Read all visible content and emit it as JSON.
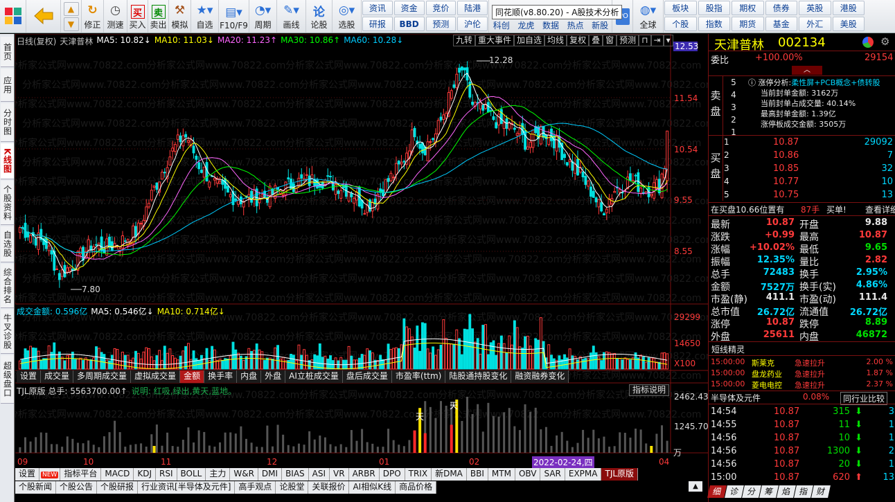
{
  "window_title": "同花顺(v8.80.20) - A股技术分析",
  "toolbar": {
    "buttons": [
      {
        "label": "修正",
        "icon": "refresh-icon"
      },
      {
        "label": "测速",
        "icon": "clock-icon"
      },
      {
        "label": "买入",
        "icon": "buy-icon",
        "glyph": "买"
      },
      {
        "label": "卖出",
        "icon": "sell-icon",
        "glyph": "卖"
      },
      {
        "label": "模拟",
        "icon": "hammer-icon"
      },
      {
        "label": "自选",
        "icon": "star-icon"
      },
      {
        "label": "F10/F9",
        "icon": "f10-icon"
      },
      {
        "label": "周期",
        "icon": "cycle-icon"
      },
      {
        "label": "画线",
        "icon": "pen-icon"
      },
      {
        "label": "论股",
        "icon": "discuss-icon"
      },
      {
        "label": "选股",
        "icon": "select-stock-icon"
      }
    ],
    "grid1": [
      "资讯",
      "资金",
      "竞价",
      "陆港",
      "研报",
      "BBD",
      "预测",
      "沪伦"
    ],
    "grid2": [
      "科创",
      "龙虎",
      "数据",
      "热点",
      "新股"
    ],
    "global_label": "全球",
    "grid3": [
      "板块",
      "股指",
      "期权",
      "债券",
      "英股",
      "港股",
      "个股",
      "指数",
      "期货",
      "基金",
      "外汇",
      "美股"
    ]
  },
  "sidebar_tabs": [
    "首页",
    "应用",
    "分时图",
    "K线图",
    "个股资料",
    "自选股",
    "综合排名",
    "牛叉诊股",
    "超级盘口"
  ],
  "kchart": {
    "header": [
      "日线(复权)",
      "天津普林",
      "MA5: 10.82↓",
      "MA10: 11.03↓",
      "MA20: 11.23↑",
      "MA30: 10.86↑",
      "MA60: 10.28↓"
    ],
    "header_colors": [
      "#c0c0c0",
      "#c0c0c0",
      "#ffffff",
      "#ffff00",
      "#ff66ff",
      "#00ff00",
      "#00ccff"
    ],
    "buttons": [
      "九转",
      "重大事件",
      "加自选",
      "均线",
      "复权",
      "叠",
      "窗",
      "预测"
    ],
    "y_ticks": [
      "12.53",
      "11.54",
      "10.54",
      "9.55",
      "8.55"
    ],
    "high_label": "12.28",
    "low_label": "7.80",
    "watermark": "分析家公式网www.70822.com"
  },
  "volume": {
    "header": [
      "成交金额: 0.596亿",
      "MA5: 0.546亿↓",
      "MA10: 0.714亿↓"
    ],
    "y_ticks": [
      "29299",
      "14650",
      "X100"
    ],
    "tabs": [
      "设置",
      "成交量",
      "多周期成交量",
      "虚拟成交量",
      "金额",
      "换手率",
      "内盘",
      "外盘",
      "AI立桩成交量",
      "盘后成交量",
      "市盈率(ttm)",
      "陆股通持股变化",
      "融资融券变化"
    ],
    "active_tab": "金额"
  },
  "tjl": {
    "title": "TJL原版 总手: 5563700.00↑",
    "note": "说明: 红吸,绿出,黄天,蓝地。",
    "explain_button": "指标说明",
    "y_ticks": [
      "2462.43",
      "1245.70"
    ],
    "unit": "万",
    "marker_tian": "天",
    "marker_xi": "吸"
  },
  "xaxis": {
    "labels": [
      "09",
      "10",
      "11",
      "12",
      "01",
      "02",
      "04"
    ],
    "cursor_date": "2022-02-24,四"
  },
  "indicator_tabs": [
    "设置",
    "NEW",
    "指标平台",
    "MACD",
    "KDJ",
    "RSI",
    "BOLL",
    "主力",
    "W&R",
    "DMI",
    "BIAS",
    "ASI",
    "VR",
    "ARBR",
    "DPO",
    "TRIX",
    "新DMA",
    "BBI",
    "MTM",
    "OBV",
    "SAR",
    "EXPMA",
    "TJL原版"
  ],
  "indicator_active": "TJL原版",
  "bottom_tabs": [
    "个股新闻",
    "个股公告",
    "个股研报",
    "行业资讯[半导体及元件]",
    "高手观点",
    "论股堂",
    "关联报价",
    "AI相似K线",
    "商品价格"
  ],
  "right_panel": {
    "stock_name": "天津普林",
    "stock_code": "002134",
    "weibi_label": "委比",
    "weibi_value": "+100.00%",
    "weibi_vol": "29154",
    "sell_label": "卖盘",
    "sell_nums": [
      "5",
      "4",
      "3",
      "2",
      "1"
    ],
    "limit_title": "涨停分析:",
    "limit_concepts": "柔性屏+PCB概念+债转股",
    "limit_lines": [
      "当前封单金额: 3162万",
      "当前封单占成交量: 40.14%",
      "最高封单金额: 1.39亿",
      "涨停板成交金额: 3505万"
    ],
    "buy_label": "买盘",
    "buy": [
      {
        "n": "1",
        "price": "10.87",
        "vol": "29092"
      },
      {
        "n": "2",
        "price": "10.86",
        "vol": "7"
      },
      {
        "n": "3",
        "price": "10.85",
        "vol": "32"
      },
      {
        "n": "4",
        "price": "10.77",
        "vol": "10"
      },
      {
        "n": "5",
        "price": "10.75",
        "vol": "13"
      }
    ],
    "queue_text": "在买盘10.66位置有",
    "queue_vol": "87手",
    "queue_tag": "买单!",
    "queue_link": "查看详细",
    "quote_rows": [
      [
        "最新",
        "10.87",
        "red",
        "开盘",
        "9.88",
        "wht"
      ],
      [
        "涨跌",
        "+0.99",
        "red",
        "最高",
        "10.87",
        "red"
      ],
      [
        "涨幅",
        "+10.02%",
        "red",
        "最低",
        "9.65",
        "grn"
      ],
      [
        "振幅",
        "12.35%",
        "cyan",
        "量比",
        "2.82",
        "red"
      ],
      [
        "总手",
        "72483",
        "cyan",
        "换手",
        "2.95%",
        "cyan"
      ],
      [
        "金额",
        "7527万",
        "cyan",
        "换手(实)",
        "4.86%",
        "cyan"
      ],
      [
        "市盈(静)",
        "411.1",
        "wht",
        "市盈(动)",
        "111.4",
        "wht"
      ],
      [
        "总市值",
        "26.72亿",
        "cyan",
        "流通值",
        "26.72亿",
        "cyan"
      ],
      [
        "涨停",
        "10.87",
        "red",
        "跌停",
        "8.89",
        "grn"
      ],
      [
        "外盘",
        "25611",
        "red",
        "内盘",
        "46872",
        "grn"
      ]
    ],
    "sprite_title": "短线精灵",
    "sprite_rows": [
      [
        "15:00:00",
        "斯莱克",
        "急速拉升",
        "2.00 %"
      ],
      [
        "15:00:00",
        "盘龙药业",
        "急速拉升",
        "1.87 %"
      ],
      [
        "15:00:00",
        "菱电电控",
        "急速拉升",
        "2.37 %"
      ]
    ],
    "industry": "半导体及元件",
    "industry_pct": "0.08%",
    "industry_btn": "同行业比较",
    "ticks": [
      [
        "14:54",
        "10.87",
        "315",
        "3"
      ],
      [
        "14:55",
        "10.87",
        "11",
        "1"
      ],
      [
        "14:56",
        "10.87",
        "10",
        "1"
      ],
      [
        "14:56",
        "10.87",
        "1300",
        "2"
      ],
      [
        "14:56",
        "10.87",
        "20",
        "1"
      ],
      [
        "15:00",
        "10.87",
        "620",
        "13"
      ]
    ],
    "bottom_tabs": [
      "细",
      "诊",
      "分",
      "筹",
      "焰",
      "指",
      "财"
    ]
  },
  "colors": {
    "up": "#ff3a3a",
    "down": "#00e0e0",
    "accent": "#b01818"
  }
}
